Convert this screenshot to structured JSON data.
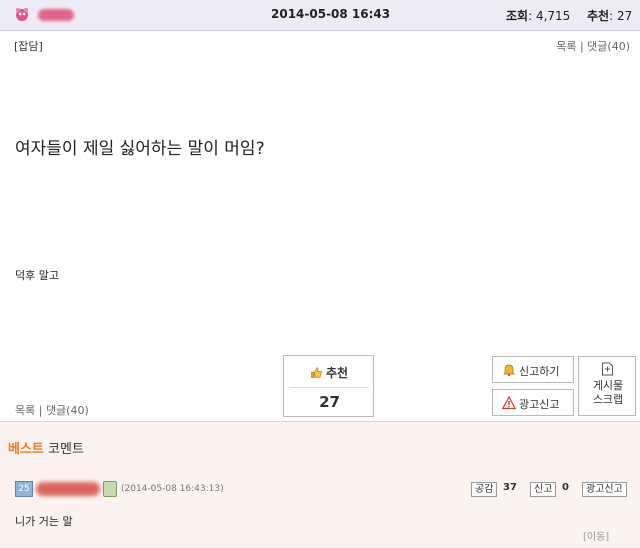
{
  "header": {
    "date": "2014-05-08 16:43",
    "views_label": "조회",
    "views_value": ": 4,715",
    "recs_label": "추천",
    "recs_value": ": 27"
  },
  "post": {
    "category": "[잡담]",
    "top_links": "목록 | 댓글(40)",
    "title": "여자들이 제일 싫어하는 말이 머임?",
    "body": "덕후 말고"
  },
  "actions": {
    "recommend_label": "추천",
    "recommend_count": "27",
    "report_label": "신고하기",
    "ad_report_label": "광고신고",
    "scrap_line1": "게시물",
    "scrap_line2": "스크랩",
    "bottom_links": "목록 | 댓글(40)"
  },
  "best_comments": {
    "title_part1": "베스트",
    "title_part2": " 코멘트",
    "comment": {
      "avatar_text": "25",
      "time": "(2014-05-08 16:43:13)",
      "agree_label": "공감",
      "agree_count": "37",
      "report_label": "신고",
      "report_count": "0",
      "ad_report_label": "광고신고",
      "text": "니가 거는 말",
      "move_label": "[이동]"
    }
  },
  "colors": {
    "header_bg": "#ecebf6",
    "comment_bg": "#fcf3f1",
    "best_accent": "#f07a1c"
  },
  "icons": [
    "site-logo-icon",
    "thumbs-up-icon",
    "bell-icon",
    "warning-icon",
    "scrap-icon",
    "user-level-icon",
    "badge-icon"
  ]
}
